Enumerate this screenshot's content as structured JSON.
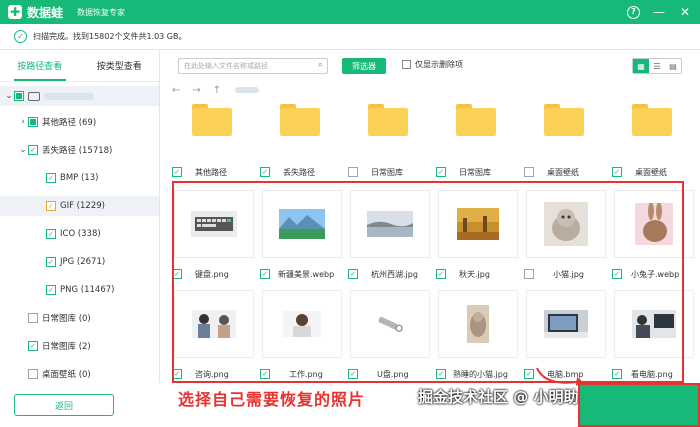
{
  "app": {
    "name": "数据蛙",
    "subtitle": "数据恢复专家"
  },
  "status": {
    "text": "扫描完成。找到15802个文件共1.03 GB。"
  },
  "tabs": {
    "path": "按路径查看",
    "type": "按类型查看"
  },
  "tree": {
    "other": "其他路径 (69)",
    "lost": "丢失路径 (15718)",
    "bmp": "BMP (13)",
    "gif": "GIF (1229)",
    "ico": "ICO (338)",
    "jpg": "JPG (2671)",
    "png": "PNG (11467)",
    "daily1": "日常图库 (0)",
    "daily2": "日常图库 (2)",
    "wallpaper": "桌面壁纸 (0)"
  },
  "toolbar": {
    "search_placeholder": "在此处输入文件名称或路径",
    "filter": "筛选器",
    "only_deleted": "仅显示删除项"
  },
  "back": "返回",
  "folders": [
    "其他路径",
    "丢失路径",
    "日常图库",
    "日常图库",
    "桌面壁纸",
    "桌面壁纸"
  ],
  "files_row1": [
    "键盘.png",
    "新疆美景.webp",
    "杭州西湖.jpg",
    "秋天.jpg",
    "小猫.jpg",
    "小兔子.webp"
  ],
  "files_row2": [
    "咨询.png",
    "工作.png",
    "U盘.png",
    "熟睡的小猫.jpg",
    "电脑.bmp",
    "看电脑.png"
  ],
  "annotation": "选择自己需要恢复的照片",
  "watermark": "掘金技术社区 @ 小明助手",
  "colors": {
    "accent": "#17b978",
    "highlight": "#e8322f"
  }
}
